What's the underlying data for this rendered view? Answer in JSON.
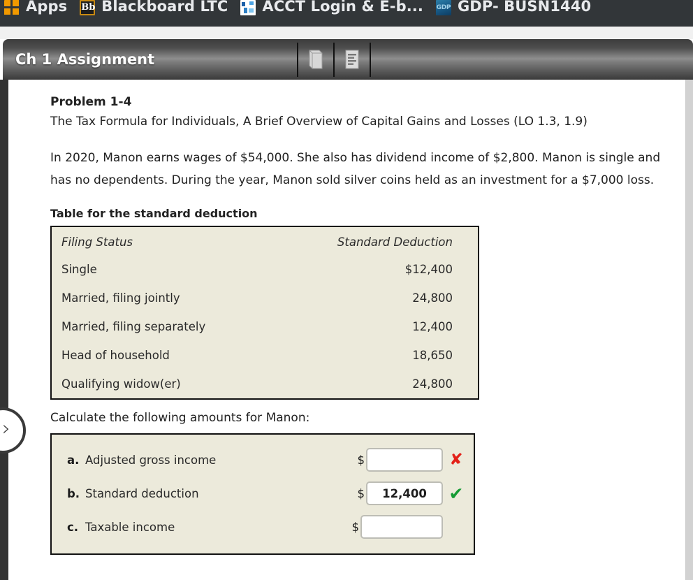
{
  "browser": {
    "bookmarks": [
      {
        "label": "Apps",
        "icon": "apps-grid-icon"
      },
      {
        "label": "Blackboard LTC",
        "icon": "blackboard-bb-icon",
        "icon_text": "Bb"
      },
      {
        "label": "ACCT Login & E-b...",
        "icon": "acct-login-icon"
      },
      {
        "label": "GDP- BUSN1440",
        "icon": "gdp-icon",
        "icon_text": "GDP"
      }
    ]
  },
  "assignment": {
    "title": "Ch 1 Assignment",
    "tools": [
      {
        "name": "ebook-icon",
        "label": "eBook"
      },
      {
        "name": "worksheet-icon",
        "label": "Worksheet"
      }
    ]
  },
  "navigation": {
    "next_arrow": "›"
  },
  "problem": {
    "number": "Problem 1-4",
    "subtitle": "The Tax Formula for Individuals, A Brief Overview of Capital Gains and Losses (LO 1.3, 1.9)",
    "body": "In 2020, Manon earns wages of $54,000. She also has dividend income of $2,800. Manon is single and has no dependents. During the year, Manon sold silver coins held as an investment for a $7,000 loss.",
    "table_caption": "Table for the standard deduction",
    "prompt": "Calculate the following amounts for Manon:"
  },
  "deduction_table": {
    "columns": [
      "Filing Status",
      "Standard Deduction"
    ],
    "rows": [
      {
        "status": "Single",
        "amount": "$12,400"
      },
      {
        "status": "Married, filing jointly",
        "amount": "24,800"
      },
      {
        "status": "Married, filing separately",
        "amount": "12,400"
      },
      {
        "status": "Head of household",
        "amount": "18,650"
      },
      {
        "status": "Qualifying widow(er)",
        "amount": "24,800"
      }
    ]
  },
  "answers": {
    "currency_symbol": "$",
    "rows": [
      {
        "letter": "a.",
        "label": "Adjusted gross income",
        "value": "",
        "mark": "✘",
        "mark_state": "incorrect"
      },
      {
        "letter": "b.",
        "label": "Standard deduction",
        "value": "12,400",
        "mark": "✔",
        "mark_state": "correct"
      },
      {
        "letter": "c.",
        "label": "Taxable income",
        "value": "",
        "mark": "",
        "mark_state": "none"
      }
    ]
  },
  "colors": {
    "panel_beige": "#ECEADB",
    "header_dark": "#3c3c3c",
    "bookmark_bar": "#323639",
    "mark_correct": "#159b34",
    "mark_incorrect": "#e32119"
  }
}
